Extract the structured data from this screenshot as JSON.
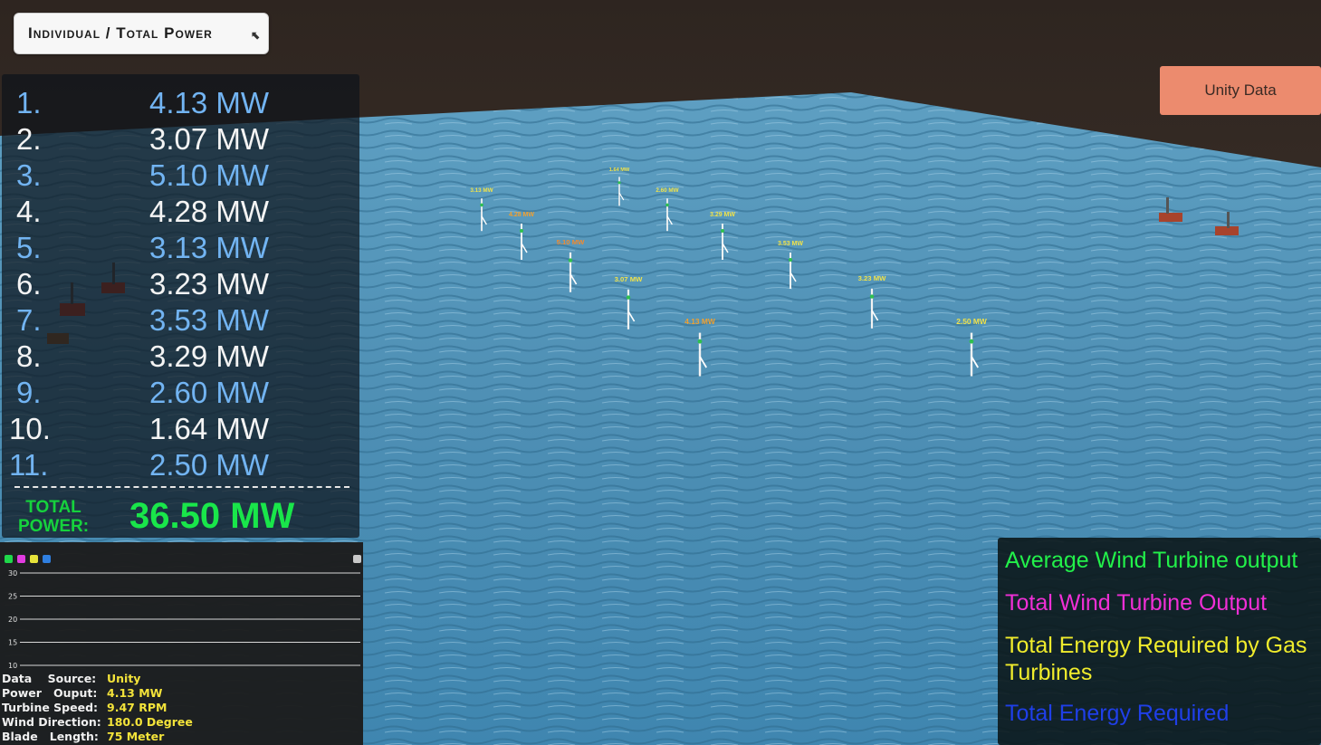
{
  "mode_button": {
    "label": "Individual / Total Power"
  },
  "unity_button": {
    "label": "Unity Data"
  },
  "turbines": [
    {
      "index": "1.",
      "power": "4.13 MW"
    },
    {
      "index": "2.",
      "power": "3.07 MW"
    },
    {
      "index": "3.",
      "power": "5.10 MW"
    },
    {
      "index": "4.",
      "power": "4.28 MW"
    },
    {
      "index": "5.",
      "power": "3.13 MW"
    },
    {
      "index": "6.",
      "power": "3.23 MW"
    },
    {
      "index": "7.",
      "power": "3.53 MW"
    },
    {
      "index": "8.",
      "power": "3.29 MW"
    },
    {
      "index": "9.",
      "power": "2.60 MW"
    },
    {
      "index": "10.",
      "power": "1.64 MW"
    },
    {
      "index": "11.",
      "power": "2.50 MW"
    }
  ],
  "total": {
    "label": "TOTAL POWER:",
    "value": "36.50 MW"
  },
  "graph": {
    "series_colors": [
      "#1fd84a",
      "#e23be0",
      "#e6e23a",
      "#2f7fe0"
    ],
    "y_ticks": [
      "30",
      "25",
      "20",
      "15",
      "10"
    ]
  },
  "info": [
    {
      "key": "Data    Source:",
      "value": "Unity"
    },
    {
      "key": "Power   Ouput:",
      "value": "4.13 MW"
    },
    {
      "key": "Turbine Speed:",
      "value": "9.47 RPM"
    },
    {
      "key": "Wind Direction:",
      "value": "180.0 Degree"
    },
    {
      "key": "Blade   Length:",
      "value": "75 Meter"
    }
  ],
  "legend": [
    {
      "label": "Average Wind Turbine output",
      "color": "#22f04a"
    },
    {
      "label": "Total Wind Turbine Output",
      "color": "#f02fd6"
    },
    {
      "label": "Total Energy Required by Gas Turbines",
      "color": "#f0ec2c"
    },
    {
      "label": "Total Energy Required",
      "color": "#1f3fe8"
    }
  ],
  "scene_labels": {
    "turbine_tags": [
      "3.13 MW",
      "4.28 MW",
      "1.64 MW",
      "2.60 MW",
      "3.29 MW",
      "5.10 MW",
      "3.53 MW",
      "3.07 MW",
      "3.23 MW",
      "4.13 MW",
      "2.50 MW"
    ]
  }
}
